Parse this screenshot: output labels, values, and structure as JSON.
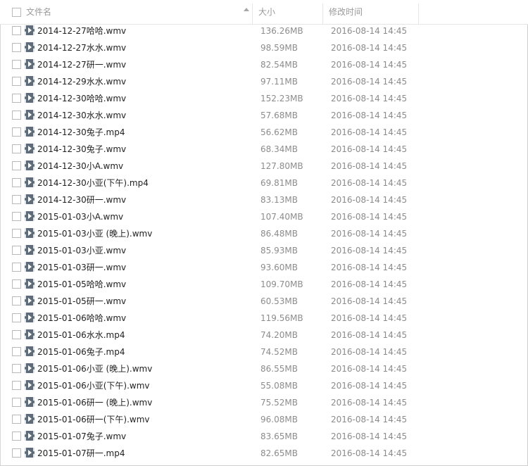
{
  "header": {
    "name_label": "文件名",
    "size_label": "大小",
    "date_label": "修改时间"
  },
  "files": [
    {
      "name": "2014-12-27哈哈.wmv",
      "size": "136.26MB",
      "date": "2016-08-14 14:45"
    },
    {
      "name": "2014-12-27水水.wmv",
      "size": "98.59MB",
      "date": "2016-08-14 14:45"
    },
    {
      "name": "2014-12-27研一.wmv",
      "size": "82.54MB",
      "date": "2016-08-14 14:45"
    },
    {
      "name": "2014-12-29水水.wmv",
      "size": "97.11MB",
      "date": "2016-08-14 14:45"
    },
    {
      "name": "2014-12-30哈哈.wmv",
      "size": "152.23MB",
      "date": "2016-08-14 14:45"
    },
    {
      "name": "2014-12-30水水.wmv",
      "size": "57.68MB",
      "date": "2016-08-14 14:45"
    },
    {
      "name": "2014-12-30兔子.mp4",
      "size": "56.62MB",
      "date": "2016-08-14 14:45"
    },
    {
      "name": "2014-12-30兔子.wmv",
      "size": "68.34MB",
      "date": "2016-08-14 14:45"
    },
    {
      "name": "2014-12-30小A.wmv",
      "size": "127.80MB",
      "date": "2016-08-14 14:45"
    },
    {
      "name": "2014-12-30小亚(下午).mp4",
      "size": "69.81MB",
      "date": "2016-08-14 14:45"
    },
    {
      "name": "2014-12-30研一.wmv",
      "size": "83.13MB",
      "date": "2016-08-14 14:45"
    },
    {
      "name": "2015-01-03小A.wmv",
      "size": "107.40MB",
      "date": "2016-08-14 14:45"
    },
    {
      "name": "2015-01-03小亚 (晚上).wmv",
      "size": "86.48MB",
      "date": "2016-08-14 14:45"
    },
    {
      "name": "2015-01-03小亚.wmv",
      "size": "85.93MB",
      "date": "2016-08-14 14:45"
    },
    {
      "name": "2015-01-03研一.wmv",
      "size": "93.60MB",
      "date": "2016-08-14 14:45"
    },
    {
      "name": "2015-01-05哈哈.wmv",
      "size": "109.70MB",
      "date": "2016-08-14 14:45"
    },
    {
      "name": "2015-01-05研一.wmv",
      "size": "60.53MB",
      "date": "2016-08-14 14:45"
    },
    {
      "name": "2015-01-06哈哈.wmv",
      "size": "119.56MB",
      "date": "2016-08-14 14:45"
    },
    {
      "name": "2015-01-06水水.mp4",
      "size": "74.20MB",
      "date": "2016-08-14 14:45"
    },
    {
      "name": "2015-01-06兔子.mp4",
      "size": "74.52MB",
      "date": "2016-08-14 14:45"
    },
    {
      "name": "2015-01-06小亚 (晚上).wmv",
      "size": "86.55MB",
      "date": "2016-08-14 14:45"
    },
    {
      "name": "2015-01-06小亚(下午).wmv",
      "size": "55.08MB",
      "date": "2016-08-14 14:45"
    },
    {
      "name": "2015-01-06研一 (晚上).wmv",
      "size": "75.52MB",
      "date": "2016-08-14 14:45"
    },
    {
      "name": "2015-01-06研一(下午).wmv",
      "size": "96.08MB",
      "date": "2016-08-14 14:45"
    },
    {
      "name": "2015-01-07兔子.wmv",
      "size": "83.65MB",
      "date": "2016-08-14 14:45"
    },
    {
      "name": "2015-01-07研一.mp4",
      "size": "82.65MB",
      "date": "2016-08-14 14:45"
    }
  ]
}
